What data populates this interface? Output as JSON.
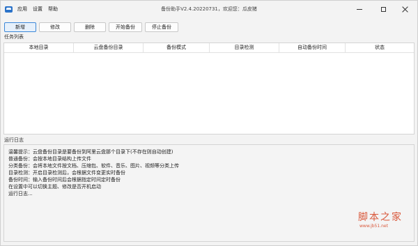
{
  "titlebar": {
    "title": "备份助手V2.4.20220731，欢迎您：瓜皮猪",
    "menu": [
      {
        "label": "应用"
      },
      {
        "label": "设置"
      },
      {
        "label": "帮助"
      }
    ]
  },
  "toolbar": {
    "buttons": [
      {
        "label": "新增"
      },
      {
        "label": "修改"
      },
      {
        "label": "删除"
      },
      {
        "label": "开始备份"
      },
      {
        "label": "停止备份"
      }
    ]
  },
  "tasks": {
    "section_label": "任务列表",
    "columns": [
      "本地目录",
      "云盘备份目录",
      "备份模式",
      "目录检测",
      "自动备份时间",
      "状态"
    ],
    "rows": []
  },
  "log": {
    "section_label": "运行日志",
    "lines": [
      "温馨提示：云盘备份目录是要备份到阿里云盘那个目录下(不存在则自动创建)",
      "普通备份：会按本地目录结构上传文件",
      "分类备份：会将本地文件按文档、压缩包、软件、音乐、图片、视频等分类上传",
      "目录检测：开启目录检测后，会根据文件变更实时备份",
      "备份时间：输入备份时间后会根据指定时间定时备份",
      "在设置中可以切换主题、修改是否开机启动",
      "运行日志..."
    ]
  },
  "watermark": {
    "text": "脚本之家",
    "url": "www.jb51.net"
  },
  "colors": {
    "accent": "#3b87d8",
    "watermark": "#d9583b"
  }
}
